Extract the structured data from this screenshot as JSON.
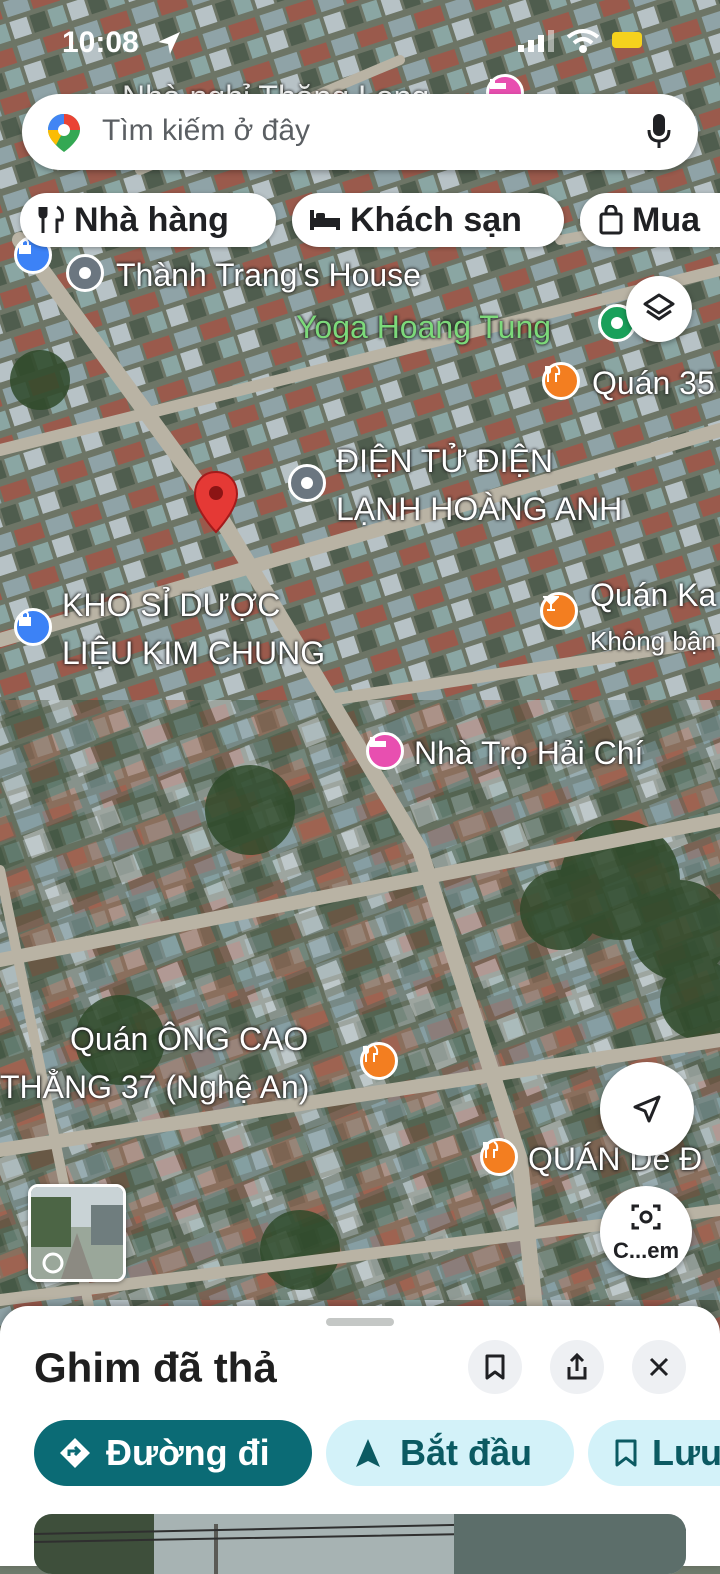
{
  "status_bar": {
    "time": "10:08"
  },
  "search": {
    "placeholder": "Tìm kiếm ở đây"
  },
  "chips": [
    {
      "label": "Nhà hàng",
      "icon": "fork-knife-icon"
    },
    {
      "label": "Khách sạn",
      "icon": "bed-icon"
    },
    {
      "label": "Mua",
      "icon": "shopping-bag-icon"
    }
  ],
  "map_labels": {
    "top_partial": "Nhà nghỉ Thăng Long",
    "thanh_trang": "Thành Trang's House",
    "yoga": "Yoga Hoang Tung",
    "quan35": "Quán 35",
    "dien_tu_1": "ĐIỆN TỬ ĐIỆN",
    "dien_tu_2": "LẠNH HOÀNG ANH",
    "kho_1": "KHO SỈ DƯỢC",
    "kho_2": "LIỆU KIM CHUNG",
    "quan_ka": "Quán Ka",
    "khong_bat": "Không bận",
    "nha_tro": "Nhà Trọ Hải Chí",
    "ong_cao_1": "Quán ÔNG CAO",
    "ong_cao_2": "THẲNG 37 (Nghệ An)",
    "quan_de": "QUÁN Dê Đ"
  },
  "camera_button": {
    "label": "C...em"
  },
  "sheet": {
    "title": "Ghim đã thả",
    "directions_label": "Đường đi",
    "start_label": "Bắt đầu",
    "save_label": "Lưu"
  },
  "colors": {
    "accent": "#0b6b75",
    "chip_blue": "#d3f2f9",
    "pin_red": "#e53935",
    "food_orange": "#f37e20",
    "hotel_pink": "#e84fb0",
    "shop_blue": "#3c82f6",
    "place_gray": "#6b7680",
    "park_green": "#19a05a"
  }
}
